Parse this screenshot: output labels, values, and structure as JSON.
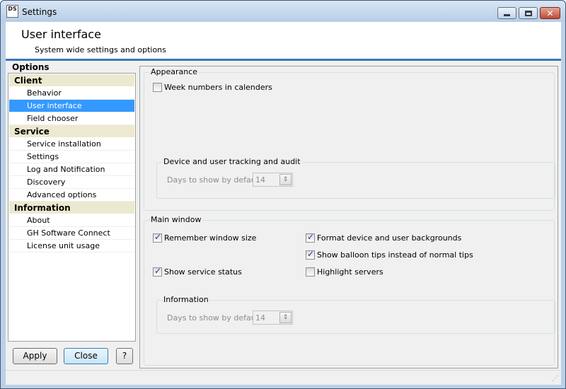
{
  "window": {
    "icon_text": "DS",
    "title": "Settings",
    "controls": [
      "minimize-icon",
      "maximize-icon",
      "close-icon"
    ]
  },
  "header": {
    "title": "User interface",
    "subtitle": "System wide settings and options"
  },
  "sidebar": {
    "label": "Options",
    "groups": [
      {
        "label": "Client",
        "items": [
          "Behavior",
          "User interface",
          "Field chooser"
        ]
      },
      {
        "label": "Service",
        "items": [
          "Service installation",
          "Settings",
          "Log and Notification",
          "Discovery",
          "Advanced options"
        ]
      },
      {
        "label": "Information",
        "items": [
          "About",
          "GH Software Connect",
          "License unit usage"
        ]
      }
    ],
    "selected": "User interface"
  },
  "buttons": {
    "apply": "Apply",
    "close": "Close",
    "help": "?"
  },
  "appearance": {
    "label": "Appearance",
    "week_numbers": {
      "label": "Week numbers in calenders",
      "checked": false
    },
    "tracking": {
      "label": "Device and user tracking and audit",
      "days_label": "Days to show by default",
      "days_value": "14"
    }
  },
  "main_window": {
    "label": "Main window",
    "remember_size": {
      "label": "Remember window size",
      "checked": true
    },
    "format_backgrounds": {
      "label": "Format device and user backgrounds",
      "checked": true
    },
    "balloon_tips": {
      "label": "Show balloon tips instead of normal tips",
      "checked": true
    },
    "service_status": {
      "label": "Show service status",
      "checked": true
    },
    "highlight_servers": {
      "label": "Highlight servers",
      "checked": false
    },
    "information": {
      "label": "Information",
      "days_label": "Days to show by default",
      "days_value": "14"
    }
  },
  "colors": {
    "selection": "#3399ff",
    "group_header": "#ece9d0",
    "header_accent": "#3d78b6"
  }
}
